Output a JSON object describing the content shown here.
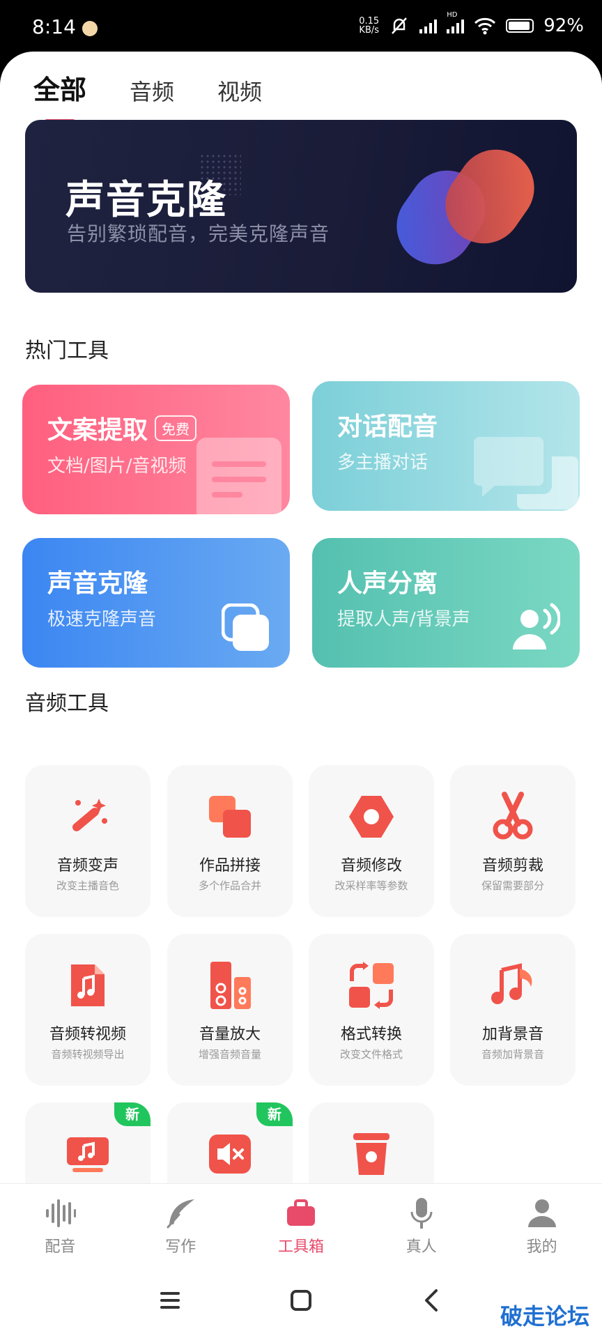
{
  "status_bar": {
    "time": "8:14",
    "net_speed_value": "0.15",
    "net_speed_unit": "KB/s",
    "battery": "92%",
    "hd_label": "HD"
  },
  "tabs": [
    {
      "label": "全部",
      "active": true
    },
    {
      "label": "音频",
      "active": false
    },
    {
      "label": "视频",
      "active": false
    }
  ],
  "banner": {
    "title": "声音克隆",
    "subtitle": "告别繁琐配音，完美克隆声音"
  },
  "hot_tools": {
    "title": "热门工具",
    "items": [
      {
        "title": "文案提取",
        "badge": "免费",
        "subtitle": "文档/图片/音视频",
        "icon": "document-icon"
      },
      {
        "title": "对话配音",
        "subtitle": "多主播对话",
        "icon": "chat-bubbles-icon"
      },
      {
        "title": "声音克隆",
        "subtitle": "极速克隆声音",
        "icon": "copy-icon"
      },
      {
        "title": "人声分离",
        "subtitle": "提取人声/背景声",
        "icon": "person-voice-icon"
      }
    ]
  },
  "audio_tools": {
    "title": "音频工具",
    "items": [
      {
        "title": "音频变声",
        "subtitle": "改变主播音色",
        "icon": "magic-wand-icon"
      },
      {
        "title": "作品拼接",
        "subtitle": "多个作品合并",
        "icon": "merge-squares-icon"
      },
      {
        "title": "音频修改",
        "subtitle": "改采样率等参数",
        "icon": "hex-nut-icon"
      },
      {
        "title": "音频剪裁",
        "subtitle": "保留需要部分",
        "icon": "scissors-icon"
      },
      {
        "title": "音频转视频",
        "subtitle": "音频转视频导出",
        "icon": "music-file-icon"
      },
      {
        "title": "音量放大",
        "subtitle": "增强音频音量",
        "icon": "speaker-icon"
      },
      {
        "title": "格式转换",
        "subtitle": "改变文件格式",
        "icon": "convert-icon"
      },
      {
        "title": "加背景音",
        "subtitle": "音频加背景音",
        "icon": "music-note-icon"
      },
      {
        "badge": "新",
        "icon": "music-screen-icon"
      },
      {
        "badge": "新",
        "icon": "mute-icon"
      },
      {
        "icon": "trash-icon"
      }
    ]
  },
  "bottom_nav": [
    {
      "label": "配音",
      "icon": "waveform-icon",
      "active": false
    },
    {
      "label": "写作",
      "icon": "feather-icon",
      "active": false
    },
    {
      "label": "工具箱",
      "icon": "toolbox-icon",
      "active": true
    },
    {
      "label": "真人",
      "icon": "microphone-icon",
      "active": false
    },
    {
      "label": "我的",
      "icon": "profile-icon",
      "active": false
    }
  ],
  "watermark": "破走论坛",
  "colors": {
    "accent": "#e84a6a",
    "tool_red": "#f0534a",
    "new_badge": "#21c55d"
  }
}
